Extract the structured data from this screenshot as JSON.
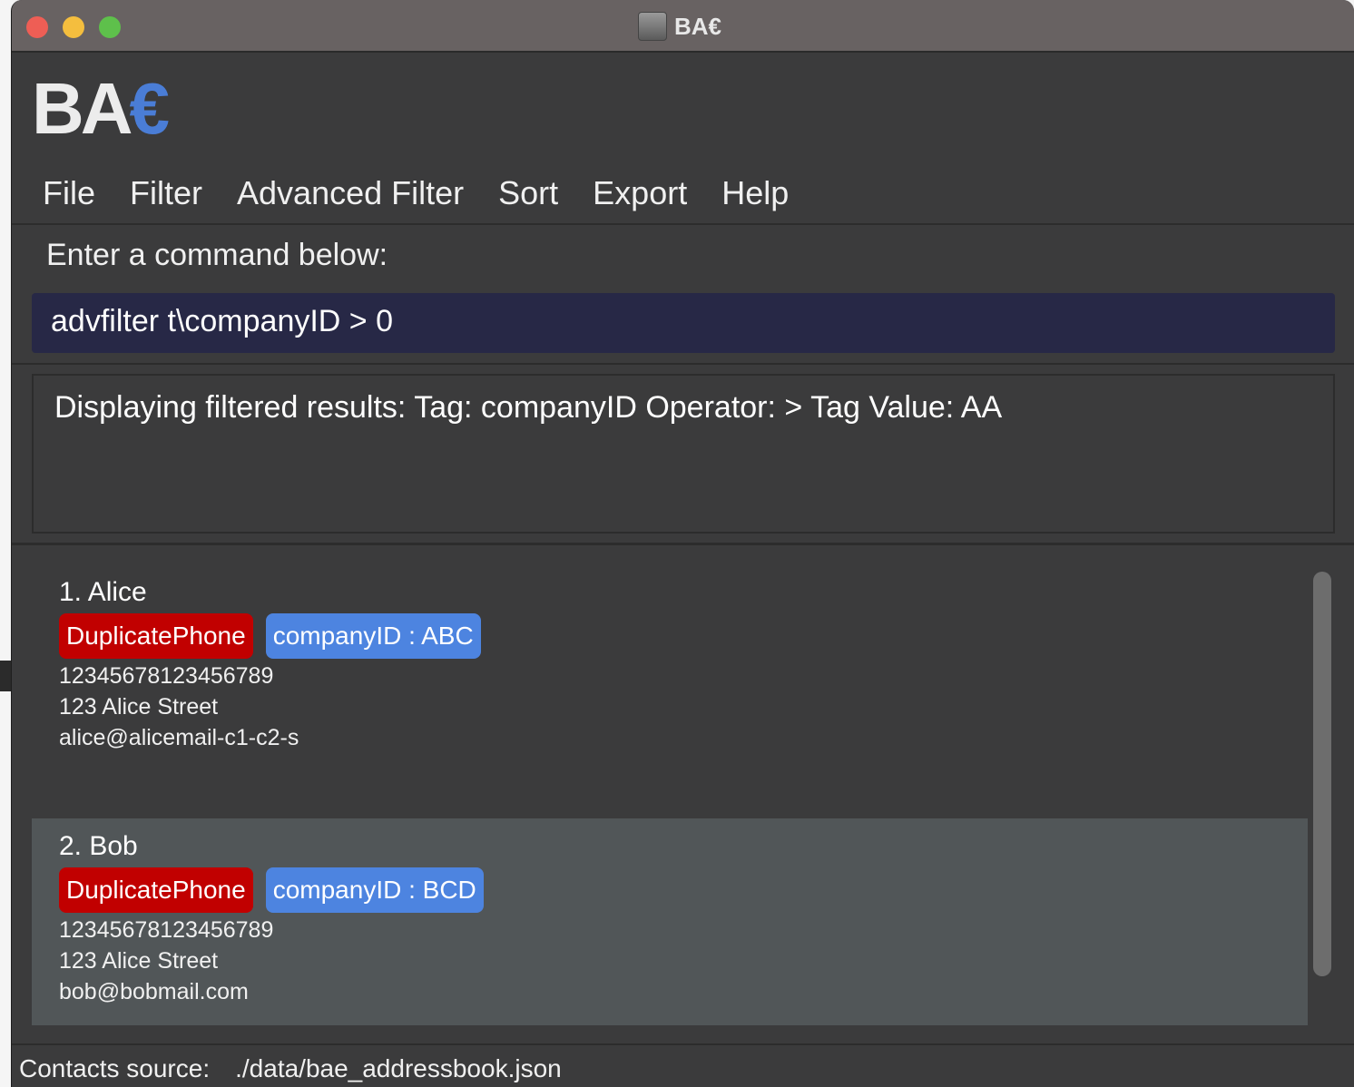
{
  "window": {
    "title": "BA€",
    "logo_main": "BA",
    "logo_accent": "€"
  },
  "menu": [
    "File",
    "Filter",
    "Advanced Filter",
    "Sort",
    "Export",
    "Help"
  ],
  "command": {
    "label": "Enter a command below:",
    "value": "advfilter t\\companyID > 0"
  },
  "result": {
    "text": "Displaying filtered results: Tag: companyID Operator: > Tag Value: AA"
  },
  "contacts": [
    {
      "title": "1. Alice",
      "tags": [
        "DuplicatePhone",
        "companyID : ABC"
      ],
      "phone": "12345678123456789",
      "address": "123 Alice Street",
      "email": "alice@alicemail-c1-c2-s"
    },
    {
      "title": "2. Bob",
      "tags": [
        "DuplicatePhone",
        "companyID : BCD"
      ],
      "phone": "12345678123456789",
      "address": "123 Alice Street",
      "email": "bob@bobmail.com"
    }
  ],
  "status": {
    "label": "Contacts source:",
    "path": "./data/bae_addressbook.json"
  },
  "colors": {
    "accent_blue": "#4a7dd6",
    "tag_red": "#c10000",
    "tag_blue": "#4d84e0",
    "command_bg": "#272846"
  }
}
